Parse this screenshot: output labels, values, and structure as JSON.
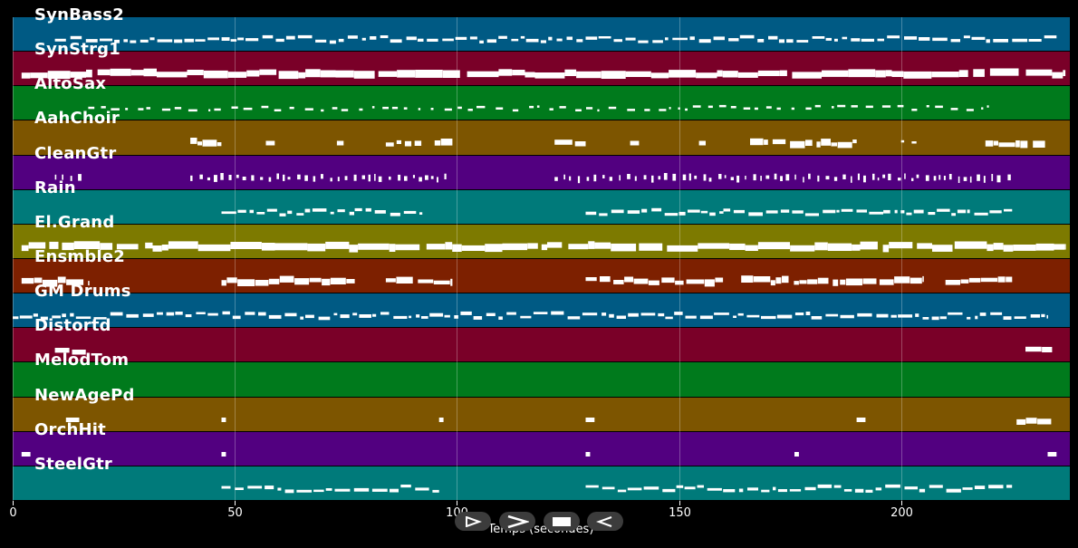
{
  "chart_data": {
    "type": "piano-roll",
    "xlabel": "Temps (secondes)",
    "xlim": [
      0,
      238
    ],
    "x_ticks": [
      0,
      50,
      100,
      150,
      200
    ],
    "tracks": [
      {
        "name": "SynBass2",
        "color": "#005a84"
      },
      {
        "name": "SynStrg1",
        "color": "#7a0028"
      },
      {
        "name": "AltoSax",
        "color": "#007a1c"
      },
      {
        "name": "AahChoir",
        "color": "#7d5500"
      },
      {
        "name": "CleanGtr",
        "color": "#520080"
      },
      {
        "name": "Rain",
        "color": "#007a7a"
      },
      {
        "name": "El.Grand",
        "color": "#7d7a00"
      },
      {
        "name": "Ensmble2",
        "color": "#7d2000"
      },
      {
        "name": "GM Drums",
        "color": "#005a84"
      },
      {
        "name": "Distortd",
        "color": "#7a0028"
      },
      {
        "name": "MelodTom",
        "color": "#007a1c"
      },
      {
        "name": "NewAgePd",
        "color": "#7d5500"
      },
      {
        "name": "OrchHit",
        "color": "#520080"
      },
      {
        "name": "SteelGtr",
        "color": "#007a7a"
      }
    ],
    "note_activity": [
      [
        [
          9.5,
          235,
          "dense-thin"
        ]
      ],
      [
        [
          2,
          237,
          "dense-thick"
        ]
      ],
      [
        [
          17,
          220,
          "sparse"
        ]
      ],
      [
        [
          40,
          47,
          "block"
        ],
        [
          57,
          59,
          "dot"
        ],
        [
          73,
          74.5,
          "dot"
        ],
        [
          84,
          92,
          "block"
        ],
        [
          95,
          99,
          "block"
        ],
        [
          122,
          129,
          "block"
        ],
        [
          139,
          141,
          "dot"
        ],
        [
          154.5,
          156,
          "dot"
        ],
        [
          166,
          174,
          "block"
        ],
        [
          175,
          190,
          "block"
        ],
        [
          200,
          205,
          "sparse"
        ],
        [
          219,
          233,
          "block"
        ]
      ],
      [
        [
          9.5,
          16,
          "ticks"
        ],
        [
          40,
          98,
          "ticks"
        ],
        [
          122,
          225,
          "ticks"
        ]
      ],
      [
        [
          47,
          77,
          "dense-thin"
        ],
        [
          77,
          84,
          "dense-thin"
        ],
        [
          85,
          93,
          "dense-thin"
        ],
        [
          129,
          160,
          "dense-thin"
        ],
        [
          160,
          196,
          "dense-thin"
        ],
        [
          196,
          225,
          "dense-thin"
        ]
      ],
      [
        [
          2,
          237,
          "dense-thick"
        ]
      ],
      [
        [
          2,
          17,
          "block"
        ],
        [
          47,
          77,
          "block"
        ],
        [
          84,
          99,
          "block"
        ],
        [
          129,
          160,
          "block"
        ],
        [
          164,
          205,
          "block"
        ],
        [
          210,
          225,
          "block"
        ]
      ],
      [
        [
          0,
          233,
          "dense-thin"
        ]
      ],
      [
        [
          9.5,
          16.5,
          "block"
        ],
        [
          228,
          234,
          "block"
        ]
      ],
      [],
      [
        [
          12,
          15,
          "dot"
        ],
        [
          47,
          48,
          "dot"
        ],
        [
          96,
          97,
          "dot"
        ],
        [
          129,
          131,
          "dot"
        ],
        [
          190,
          192,
          "dot"
        ],
        [
          226,
          234,
          "block"
        ]
      ],
      [
        [
          2,
          4,
          "dot"
        ],
        [
          47,
          48,
          "dot"
        ],
        [
          129,
          130,
          "dot"
        ],
        [
          176,
          177,
          "dot"
        ],
        [
          233,
          235,
          "dot"
        ]
      ],
      [
        [
          47,
          96,
          "dense-thin"
        ],
        [
          129,
          225,
          "dense-thin"
        ]
      ]
    ]
  },
  "controls": {
    "play_label": "play",
    "forward_label": "forward",
    "stop_label": "stop",
    "back_label": "back"
  }
}
